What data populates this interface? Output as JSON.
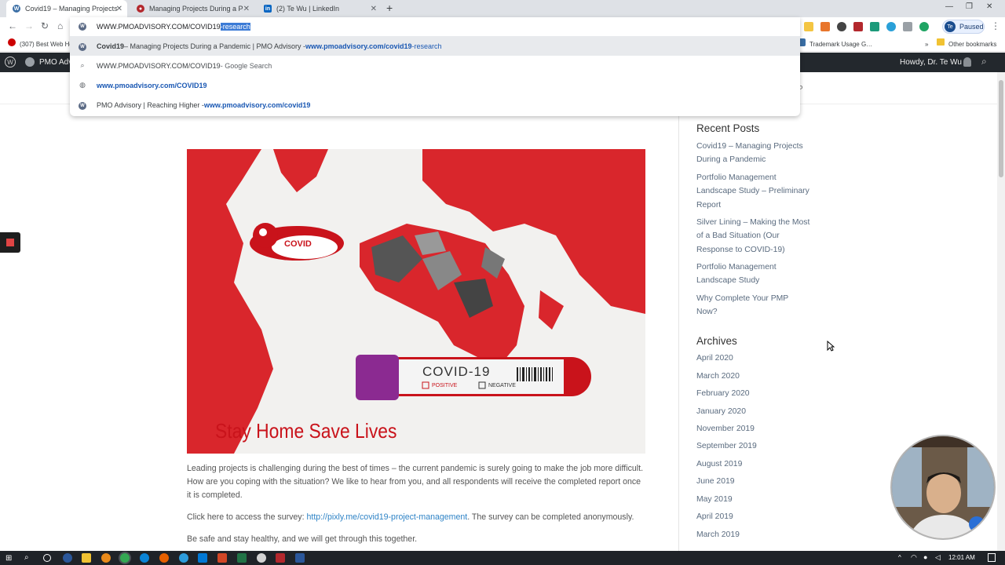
{
  "browser": {
    "tabs": [
      {
        "title": "Covid19 – Managing Projects Du",
        "active": true
      },
      {
        "title": "Managing Projects During a Pan",
        "active": false
      },
      {
        "title": "(2) Te Wu | LinkedIn",
        "active": false
      }
    ],
    "address": {
      "typed": "WWW.PMOADVISORY.COM/COVID19",
      "completion": "-research"
    },
    "profile": {
      "initials": "Te",
      "label": "Paused"
    },
    "bookmarks": [
      "(307) Best Web Ho…",
      "Trademark Usage G…",
      "Other bookmarks"
    ],
    "suggestions": [
      {
        "title_bold": "Covid19",
        "title_rest": " – Managing Projects During a Pandemic | PMO Advisory - ",
        "url_bold": "www.pmoadvisory.com/covid19",
        "url_rest": "-research",
        "icon": "wordpress-icon"
      },
      {
        "text": "WWW.PMOADVISORY.COM/COVID19",
        "suffix": " - Google Search",
        "icon": "search-icon"
      },
      {
        "url_bold": "www.pmoadvisory.com/COVID19",
        "icon": "globe-icon"
      },
      {
        "title": "PMO Advisory | Reaching Higher - ",
        "url_bold": "www.pmoadvisory.com/covid19",
        "icon": "wordpress-icon"
      }
    ]
  },
  "wp_admin": {
    "site": "PMO Adv",
    "greeting": "Howdy, Dr. Te Wu"
  },
  "article": {
    "image_text": {
      "pin": "COVID",
      "tube": "COVID-19",
      "positive": "POSITIVE",
      "negative": "NEGATIVE"
    },
    "image_caption": "Stay Home Save Lives",
    "para1": "Leading projects is challenging during the best of times – the current pandemic is surely going to make the job more difficult.  How are you coping with the situation?  We like to hear from you, and all respondents will receive the completed report once it is completed.",
    "para2_pre": "Click here to access the survey: ",
    "para2_link": "http://pixly.me/covid19-project-management",
    "para2_post": ". The survey can be completed anonymously.",
    "para3": "Be safe and stay healthy, and we will get through this together."
  },
  "sidebar": {
    "recent_title": "Recent Posts",
    "recent": [
      "Covid19 – Managing Projects During a Pandemic",
      "Portfolio Management Landscape Study – Preliminary Report",
      "Silver Lining – Making the Most of a Bad Situation (Our Response to COVID-19)",
      "Portfolio Management Landscape Study",
      "Why Complete Your PMP Now?"
    ],
    "archives_title": "Archives",
    "archives": [
      "April 2020",
      "March 2020",
      "February 2020",
      "January 2020",
      "November 2019",
      "September 2019",
      "August 2019",
      "June 2019",
      "May 2019",
      "April 2019",
      "March 2019"
    ]
  },
  "taskbar": {
    "time": "12:01 AM"
  }
}
